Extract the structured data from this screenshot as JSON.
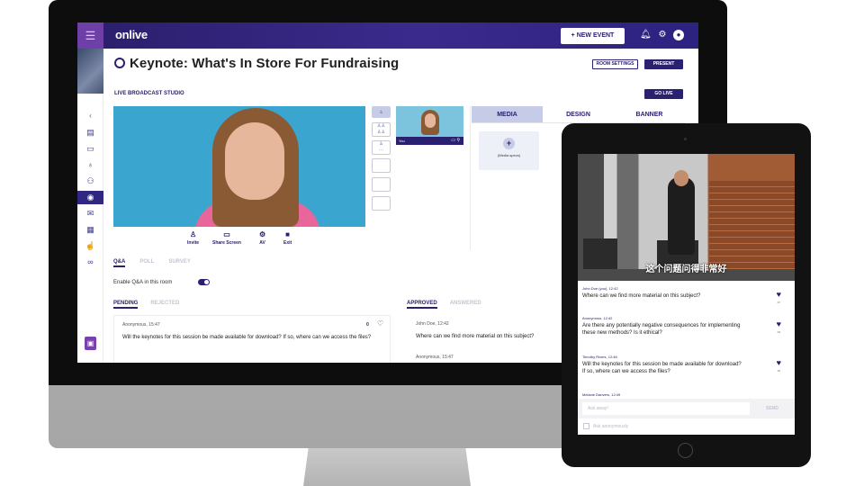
{
  "app": {
    "logo": "onlive",
    "new_event": "+ NEW EVENT",
    "menu_icon": "hamburger-icon",
    "topbar_icons": [
      "bell-icon",
      "gear-icon",
      "user-icon"
    ]
  },
  "page": {
    "title": "Keynote: What's In Store For Fundraising",
    "room_settings": "ROOM SETTINGS",
    "present": "PRESENT",
    "studio_label": "LIVE BROADCAST STUDIO",
    "go_live": "GO LIVE"
  },
  "controls": {
    "invite": "Invite",
    "share_screen": "Share Screen",
    "av": "AV",
    "exit": "Exit"
  },
  "self_preview": {
    "label": "You"
  },
  "media_panel": {
    "tabs": [
      "MEDIA",
      "DESIGN",
      "BANNER"
    ],
    "media_specs": "(Media specs)"
  },
  "qa": {
    "tabs": [
      "Q&A",
      "POLL",
      "SURVEY"
    ],
    "enable_label": "Enable Q&A in this room",
    "left_tabs": [
      "PENDING",
      "REJECTED"
    ],
    "right_tabs": [
      "APPROVED",
      "ANSWERED"
    ],
    "pending": {
      "meta": "Anonymous, 15:47",
      "text": "Will the keynotes for this session be made available for download? If so, where can we access the files?",
      "count": "0"
    },
    "approved": [
      {
        "meta": "John Doe, 12:42",
        "text": "Where can we find more material on this subject?"
      },
      {
        "meta": "Anonymous, 15:47",
        "text": ""
      }
    ]
  },
  "tablet": {
    "caption": "这个问题问得非常好",
    "questions": [
      {
        "who": "John Doe (you), 12:42",
        "text": "Where can we find more material on this subject?",
        "likes": "47"
      },
      {
        "who": "Anonymous, 12:42",
        "text": "Are there any potentially negative consequences for implementing these new methods? Is it ethical?",
        "likes": "33"
      },
      {
        "who": "Timothy Rivers, 12:46",
        "text": "Will the keynotes for this session be made available for download? If so, where can we access the files?",
        "likes": "16"
      },
      {
        "who": "Melanie Danvers, 12:49",
        "text": "",
        "likes": ""
      }
    ],
    "input_placeholder": "Ask away!",
    "send": "SEND",
    "ask_anon": "Ask anonymously"
  },
  "colors": {
    "brand": "#2a2070",
    "accent_purple": "#6e3fa7",
    "tab_selected": "#c6cce8"
  }
}
